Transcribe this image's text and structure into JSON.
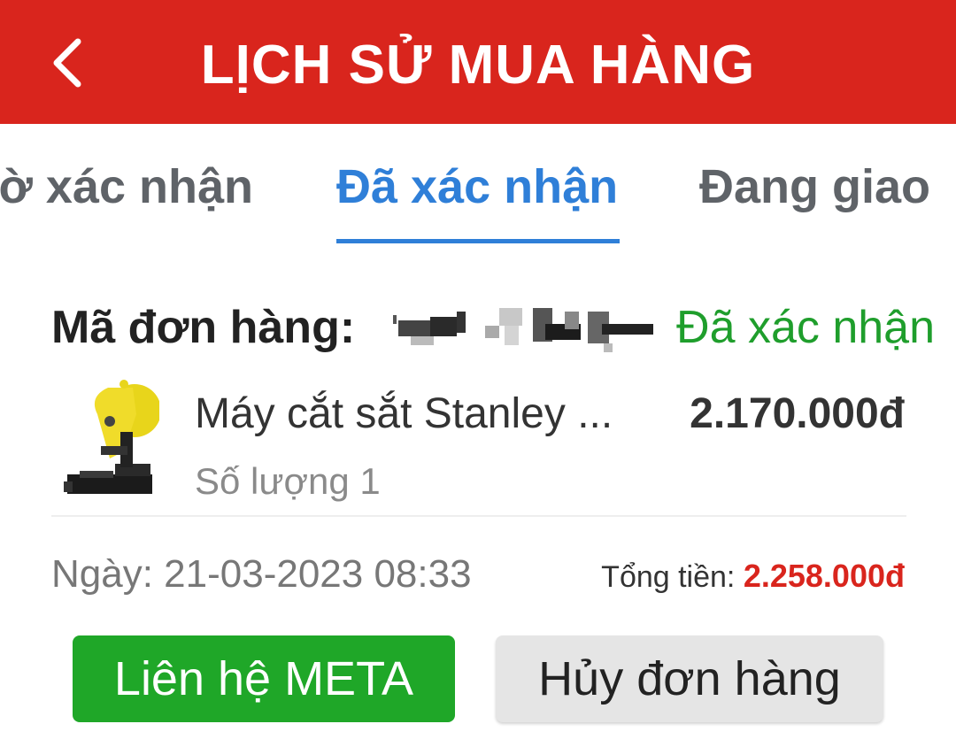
{
  "header": {
    "title": "LỊCH SỬ MUA HÀNG",
    "back_icon": "chevron-left-icon",
    "background_color": "#d9251d"
  },
  "tabs": [
    {
      "label": "ờ xác nhận",
      "active": false
    },
    {
      "label": "Đã xác nhận",
      "active": true
    },
    {
      "label": "Đang giao",
      "active": false
    }
  ],
  "accent_color": "#2f7fd8",
  "order": {
    "code_label": "Mã đơn hàng:",
    "status": "Đã xác nhận",
    "status_color": "#1f9e2c",
    "product": {
      "name": "Máy cắt sắt Stanley ...",
      "price": "2.170.000đ",
      "quantity": "Số lượng 1",
      "image": "cut-off-saw-image"
    },
    "date": "Ngày: 21-03-2023 08:33",
    "total_label": "Tổng tiền:",
    "total_value": "2.258.000đ"
  },
  "actions": {
    "contact_label": "Liên hệ META",
    "cancel_label": "Hủy đơn hàng"
  }
}
